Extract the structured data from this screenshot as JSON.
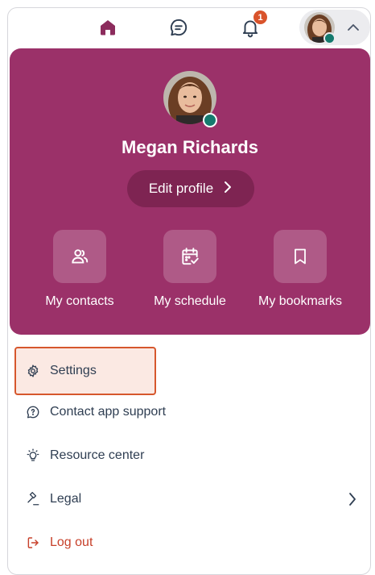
{
  "topbar": {
    "home_icon": "home-icon",
    "chat_icon": "chat-icon",
    "bell_icon": "bell-icon",
    "notification_count": "1",
    "caret_icon": "chevron-up-icon"
  },
  "profile": {
    "name": "Megan Richards",
    "edit_label": "Edit profile",
    "status_color": "#157a6e"
  },
  "shortcuts": [
    {
      "label": "My contacts",
      "icon": "contacts-icon"
    },
    {
      "label": "My schedule",
      "icon": "calendar-check-icon"
    },
    {
      "label": "My bookmarks",
      "icon": "bookmark-icon"
    }
  ],
  "menu": [
    {
      "label": "Settings",
      "icon": "gear-icon"
    },
    {
      "label": "Contact app support",
      "icon": "help-chat-icon"
    },
    {
      "label": "Resource center",
      "icon": "lightbulb-icon"
    },
    {
      "label": "Legal",
      "icon": "gavel-icon"
    },
    {
      "label": "Log out",
      "icon": "logout-icon"
    }
  ],
  "colors": {
    "brand": "#9b3169",
    "accent_warning": "#d6572d",
    "logout": "#c7402a"
  }
}
